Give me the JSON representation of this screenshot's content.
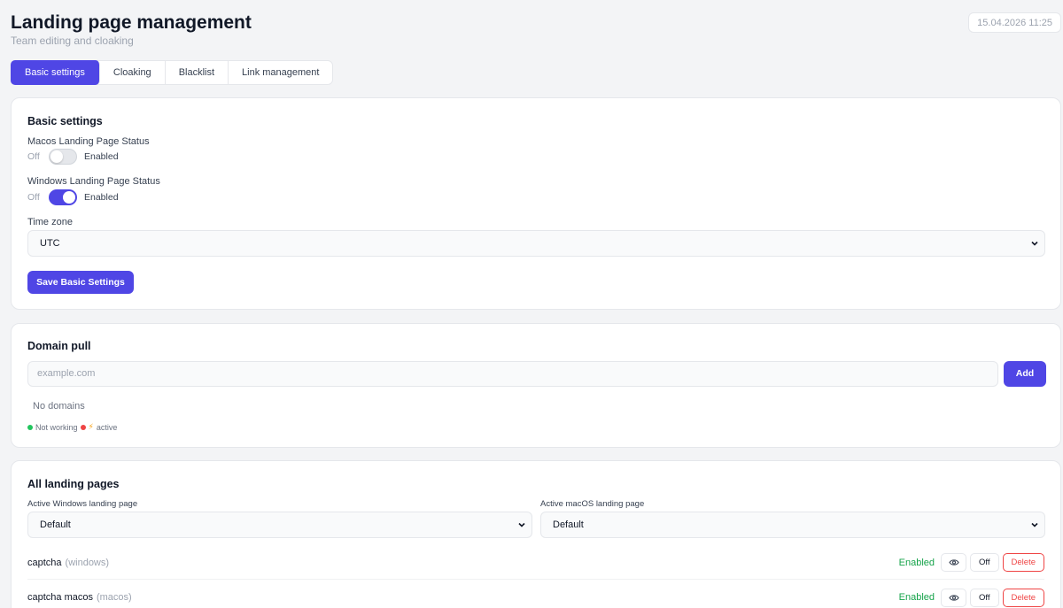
{
  "header": {
    "title": "Landing page management",
    "subtitle": "Team editing and cloaking",
    "datetime": "15.04.2026 11:25"
  },
  "tabs": [
    {
      "label": "Basic settings",
      "active": true
    },
    {
      "label": "Cloaking",
      "active": false
    },
    {
      "label": "Blacklist",
      "active": false
    },
    {
      "label": "Link management",
      "active": false
    }
  ],
  "basic": {
    "title": "Basic settings",
    "macos_label": "Macos Landing Page Status",
    "macos_enabled": false,
    "windows_label": "Windows Landing Page Status",
    "windows_enabled": true,
    "toggle_off_text": "Off",
    "toggle_on_text": "Enabled",
    "timezone_label": "Time zone",
    "timezone_value": "UTC",
    "save_label": "Save Basic Settings"
  },
  "domains": {
    "title": "Domain pull",
    "input_placeholder": "example.com",
    "add_label": "Add",
    "empty_text": "No domains",
    "legend_not_working": "Not working",
    "legend_active": "active"
  },
  "landing": {
    "title": "All landing pages",
    "windows_select_label": "Active Windows landing page",
    "windows_select_value": "Default",
    "macos_select_label": "Active macOS landing page",
    "macos_select_value": "Default",
    "rows": [
      {
        "name": "captcha",
        "os": "(windows)",
        "status": "Enabled",
        "off_label": "Off",
        "delete_label": "Delete"
      },
      {
        "name": "captcha macos",
        "os": "(macos)",
        "status": "Enabled",
        "off_label": "Off",
        "delete_label": "Delete"
      }
    ]
  },
  "colors": {
    "accent": "#4f46e5",
    "enabled_green": "#16a34a",
    "not_working_dot": "#22c55e",
    "red_dot": "#ef4444",
    "active_star": "#f59e0b"
  }
}
